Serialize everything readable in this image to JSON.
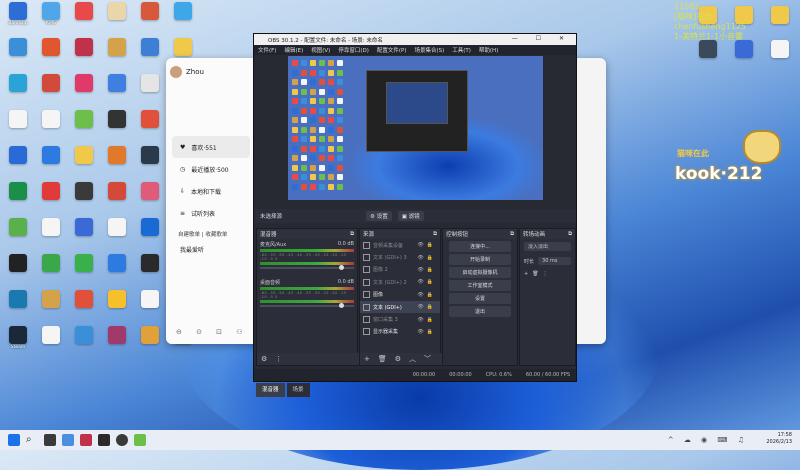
{
  "desktop": {
    "icons": [
      {
        "label": "Bandizip",
        "color": "#2d6dd6"
      },
      {
        "label": "KMS",
        "color": "#4fa6e8"
      },
      {
        "label": "",
        "color": "#e84a4a"
      },
      {
        "label": "",
        "color": "#e9d7a9"
      },
      {
        "label": "",
        "color": "#d8583c"
      },
      {
        "label": "",
        "color": "#3da7e8"
      },
      {
        "label": "",
        "color": "#3a8fd8"
      },
      {
        "label": "",
        "color": "#e0562f"
      },
      {
        "label": "",
        "color": "#c0314a"
      },
      {
        "label": "",
        "color": "#d4a24b"
      },
      {
        "label": "",
        "color": "#3e7fd6"
      },
      {
        "label": "",
        "color": "#f0c94a"
      },
      {
        "label": "",
        "color": "#2aa3d6"
      },
      {
        "label": "",
        "color": "#d14a3b"
      },
      {
        "label": "",
        "color": "#e03a6a"
      },
      {
        "label": "",
        "color": "#3f7fe0"
      },
      {
        "label": "",
        "color": "#e5e5e5"
      },
      {
        "label": "",
        "color": "#5c3a9a"
      },
      {
        "label": "",
        "color": "#f5f5f5"
      },
      {
        "label": "",
        "color": "#f5f5f5"
      },
      {
        "label": "",
        "color": "#6bbf4a"
      },
      {
        "label": "",
        "color": "#333333"
      },
      {
        "label": "",
        "color": "#e0503a"
      },
      {
        "label": "",
        "color": "#f5f5f5"
      },
      {
        "label": "",
        "color": "#2a6ad6"
      },
      {
        "label": "",
        "color": "#2d7be0"
      },
      {
        "label": "",
        "color": "#f0c94a"
      },
      {
        "label": "",
        "color": "#e07a2a"
      },
      {
        "label": "",
        "color": "#2a3a4a"
      },
      {
        "label": "",
        "color": "#f5f5f5"
      },
      {
        "label": "",
        "color": "#1a8f4a"
      },
      {
        "label": "",
        "color": "#e03a3a"
      },
      {
        "label": "",
        "color": "#3a3a3a"
      },
      {
        "label": "",
        "color": "#d44a3a"
      },
      {
        "label": "",
        "color": "#e05a7a"
      },
      {
        "label": "",
        "color": "#f5f5f5"
      },
      {
        "label": "",
        "color": "#5ab04a"
      },
      {
        "label": "",
        "color": "#f5f5f5"
      },
      {
        "label": "",
        "color": "#3a6ad6"
      },
      {
        "label": "",
        "color": "#f5f5f5"
      },
      {
        "label": "",
        "color": "#1a6ad6"
      },
      {
        "label": "",
        "color": "#f5f5f5"
      },
      {
        "label": "",
        "color": "#222222"
      },
      {
        "label": "",
        "color": "#3aa84a"
      },
      {
        "label": "",
        "color": "#3ab04a"
      },
      {
        "label": "",
        "color": "#2d7be0"
      },
      {
        "label": "",
        "color": "#2a2a2a"
      },
      {
        "label": "",
        "color": "#f5f5f5"
      },
      {
        "label": "",
        "color": "#1a7ab0"
      },
      {
        "label": "",
        "color": "#d4a24b"
      },
      {
        "label": "",
        "color": "#e0503a"
      },
      {
        "label": "",
        "color": "#f5c02a"
      },
      {
        "label": "",
        "color": "#f5f5f5"
      },
      {
        "label": "",
        "color": "#f5f5f5"
      },
      {
        "label": "Steam",
        "color": "#1b2838"
      },
      {
        "label": "",
        "color": "#f5f5f5"
      },
      {
        "label": "",
        "color": "#3a8fd8"
      },
      {
        "label": "",
        "color": "#a03a6a"
      },
      {
        "label": "",
        "color": "#e0a03a"
      },
      {
        "label": "",
        "color": "#f5f5f5"
      }
    ],
    "right_icons": [
      {
        "label": "",
        "color": "#f0c94a"
      },
      {
        "label": "",
        "color": "#f0c94a"
      },
      {
        "label": "",
        "color": "#f0c94a"
      },
      {
        "label": "",
        "color": "#3a4a5a"
      },
      {
        "label": "",
        "color": "#3a6ad6"
      },
      {
        "label": "",
        "color": "#f5f5f5"
      }
    ]
  },
  "overlay": {
    "line1": "11582",
    "line2": "[猫咪]在此",
    "line3": "chenfusheng1125",
    "line4": "1-美特兰1-1小音響",
    "kook_small": "猫咪在此",
    "kook_big": "kook·212"
  },
  "music_app": {
    "username": "Zhou",
    "menu": [
      {
        "label": "喜欢·551",
        "icon": "heart-icon",
        "active": true
      },
      {
        "label": "最近播放·500",
        "icon": "clock-icon",
        "active": false
      },
      {
        "label": "本地和下载",
        "icon": "download-icon",
        "active": false
      },
      {
        "label": "试听列表",
        "icon": "list-icon",
        "active": false
      }
    ],
    "section_title": "自建歌单 | 收藏歌单",
    "playlist": "我最爱听"
  },
  "obs": {
    "title": "OBS 30.1.2 - 配置文件: 未命名 - 场景: 未命名",
    "menu": [
      "文件(F)",
      "编辑(E)",
      "视图(V)",
      "停靠窗口(D)",
      "配置文件(P)",
      "场景集合(S)",
      "工具(T)",
      "帮助(H)"
    ],
    "no_source": "未选择源",
    "properties_btn": "⚙ 设置",
    "filters_btn": "▣ 滤镜",
    "mixer": {
      "title": "混音器",
      "tracks": [
        {
          "name": "麦克风/Aux",
          "db": "0.0 dB"
        },
        {
          "name": "桌面音频",
          "db": "0.0 dB"
        }
      ],
      "ticks": "-60 -55 -50 -45 -40 -35 -30 -25 -20 -15 -10 -5 0"
    },
    "sources": {
      "title": "来源",
      "items": [
        {
          "label": "音频采集设备",
          "state": "dim"
        },
        {
          "label": "文本 (GDI+) 3",
          "state": "dim"
        },
        {
          "label": "图像 2",
          "state": "dim"
        },
        {
          "label": "文本 (GDI+) 2",
          "state": "dim"
        },
        {
          "label": "图像",
          "state": "on"
        },
        {
          "label": "文本 (GDI+)",
          "state": "sel"
        },
        {
          "label": "窗口采集 3",
          "state": "dim"
        },
        {
          "label": "显示器采集",
          "state": "on"
        }
      ]
    },
    "controls": {
      "title": "控制按钮",
      "buttons": [
        "连接中...",
        "开始录制",
        "启动虚拟摄像机",
        "工作室模式",
        "设置",
        "退出"
      ]
    },
    "transitions": {
      "title": "转场动画",
      "type": "淡入淡出",
      "duration_label": "时长",
      "duration": "30 ms"
    },
    "tabs": [
      "混音器",
      "场景"
    ],
    "status": {
      "stream_time": "00:00:00",
      "rec_time": "00:00:00",
      "cpu": "CPU: 0.6%",
      "fps": "60.00 / 60.00 FPS"
    }
  },
  "taskbar": {
    "time": "17:58",
    "date": "2026/2/13"
  }
}
